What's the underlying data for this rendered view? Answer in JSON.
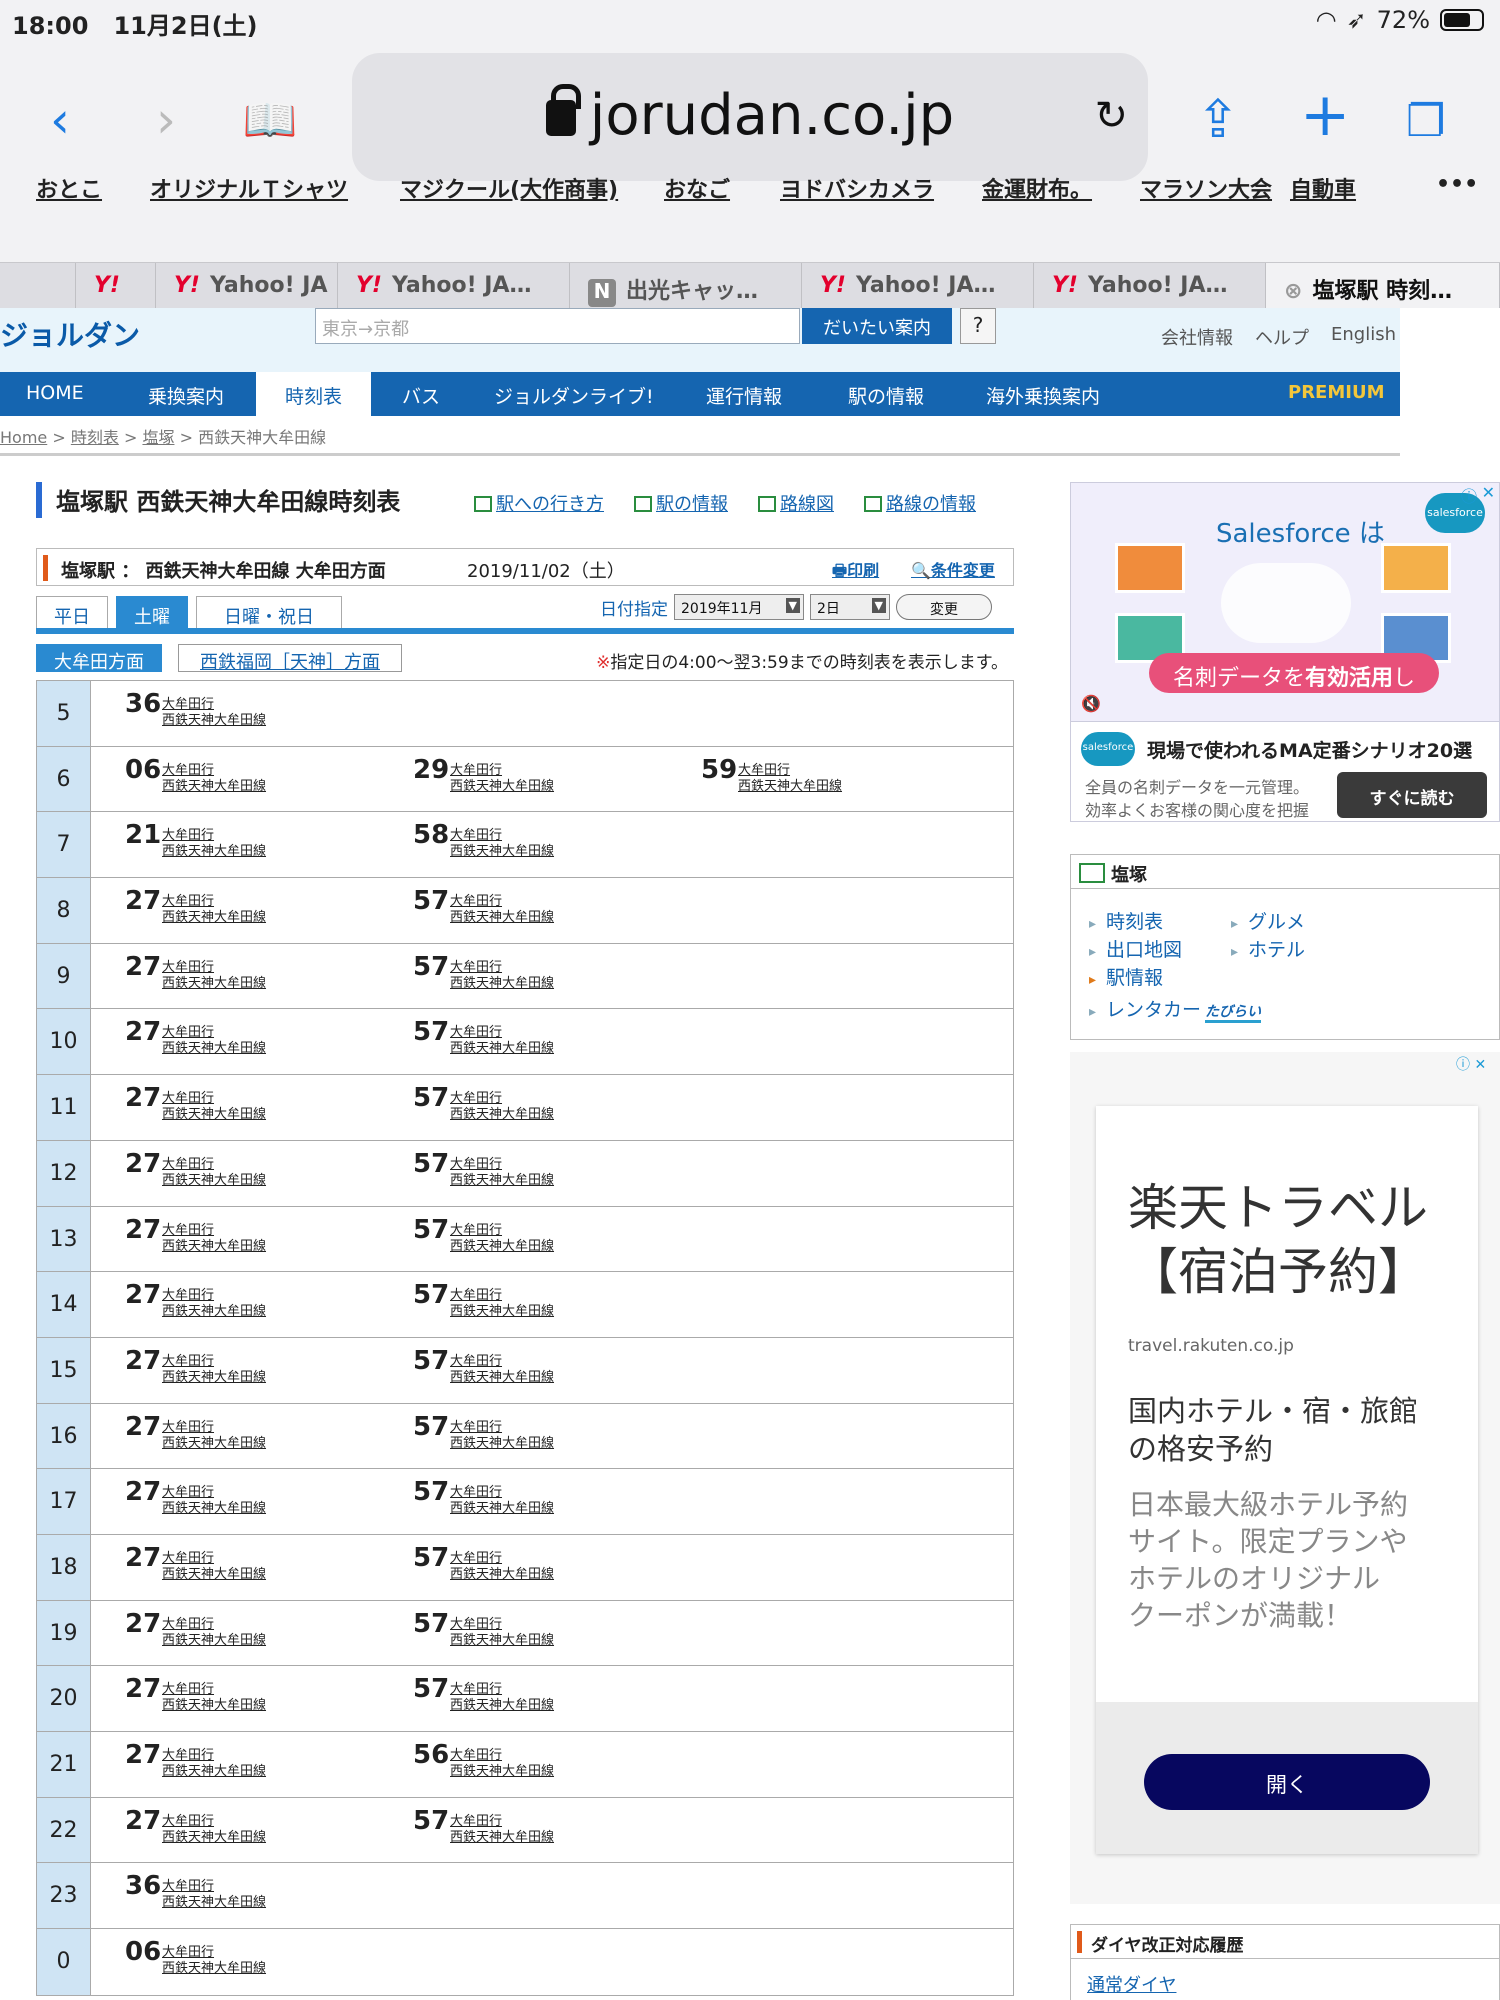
{
  "status": {
    "time": "18:00",
    "date": "11月2日(土)",
    "battery": "72%",
    "battery_level": 0.72
  },
  "browser": {
    "url": "jorudan.co.jp"
  },
  "bookmarks": [
    "おとこ",
    "オリジナルＴシャツ",
    "マジクール(大作商事)",
    "おなご",
    "ヨドバシカメラ",
    "金運財布。",
    "マラソン大会",
    "自動車"
  ],
  "tabs": [
    {
      "label": "Yahoo! JA",
      "favicon": "Y!"
    },
    {
      "label": "Yahoo! JA…",
      "favicon": "Y!"
    },
    {
      "label": "出光キャッ…",
      "favicon": "N"
    },
    {
      "label": "Yahoo! JA…",
      "favicon": "Y!"
    },
    {
      "label": "Yahoo! JA…",
      "favicon": "Y!"
    },
    {
      "label": "塩塚駅 時刻…",
      "favicon": "close"
    }
  ],
  "site": {
    "logo": "ジョルダン",
    "search_placeholder": "東京→京都",
    "search_button": "だいたい案内",
    "help_button": "?",
    "header_links": [
      "会社情報",
      "ヘルプ",
      "English"
    ],
    "nav": [
      "HOME",
      "乗換案内",
      "時刻表",
      "バス",
      "ジョルダンライブ!",
      "運行情報",
      "駅の情報",
      "海外乗換案内"
    ],
    "premium": "PREMIUM",
    "breadcrumb": [
      "Home",
      "時刻表",
      "塩塚",
      "西鉄天神大牟田線"
    ],
    "breadcrumb_sep": ">"
  },
  "main": {
    "title": "塩塚駅 西鉄天神大牟田線時刻表",
    "title_links": [
      "駅への行き方",
      "駅の情報",
      "路線図",
      "路線の情報"
    ],
    "info": "塩塚駅 ： 西鉄天神大牟田線 大牟田方面",
    "info_date": "2019/11/02（土）",
    "print": "印刷",
    "change_cond": "条件変更",
    "day_tabs": [
      "平日",
      "土曜",
      "日曜・祝日"
    ],
    "date_label": "日付指定",
    "month_select": "2019年11月",
    "day_select": "2日",
    "change_button": "変更",
    "dir_tabs": [
      "大牟田方面",
      "西鉄福岡［天神］方面"
    ],
    "note_mark": "※",
    "note": "指定日の4:00〜翌3:59までの時刻表を表示します。",
    "dest": "大牟田行",
    "line": "西鉄天神大牟田線"
  },
  "timetable": [
    {
      "hour": "5",
      "mins": [
        "36"
      ]
    },
    {
      "hour": "6",
      "mins": [
        "06",
        "29",
        "59"
      ]
    },
    {
      "hour": "7",
      "mins": [
        "21",
        "58"
      ]
    },
    {
      "hour": "8",
      "mins": [
        "27",
        "57"
      ]
    },
    {
      "hour": "9",
      "mins": [
        "27",
        "57"
      ]
    },
    {
      "hour": "10",
      "mins": [
        "27",
        "57"
      ]
    },
    {
      "hour": "11",
      "mins": [
        "27",
        "57"
      ]
    },
    {
      "hour": "12",
      "mins": [
        "27",
        "57"
      ]
    },
    {
      "hour": "13",
      "mins": [
        "27",
        "57"
      ]
    },
    {
      "hour": "14",
      "mins": [
        "27",
        "57"
      ]
    },
    {
      "hour": "15",
      "mins": [
        "27",
        "57"
      ]
    },
    {
      "hour": "16",
      "mins": [
        "27",
        "57"
      ]
    },
    {
      "hour": "17",
      "mins": [
        "27",
        "57"
      ]
    },
    {
      "hour": "18",
      "mins": [
        "27",
        "57"
      ]
    },
    {
      "hour": "19",
      "mins": [
        "27",
        "57"
      ]
    },
    {
      "hour": "20",
      "mins": [
        "27",
        "57"
      ]
    },
    {
      "hour": "21",
      "mins": [
        "27",
        "56"
      ]
    },
    {
      "hour": "22",
      "mins": [
        "27",
        "57"
      ]
    },
    {
      "hour": "23",
      "mins": [
        "36"
      ]
    },
    {
      "hour": "0",
      "mins": [
        "06"
      ]
    }
  ],
  "sidebar": {
    "ad1": {
      "brand": "Salesforce は",
      "pill_pre": "名刺データを",
      "pill_bold": "有効活用",
      "pill_post": "し",
      "logo": "salesforce",
      "small_logo": "salesforce",
      "headline": "現場で使われるMA定番シナリオ20選",
      "body1": "全員の名刺データを一元管理。",
      "body2": "効率よくお客様の関心度を把握",
      "button": "すぐに読む"
    },
    "station": {
      "title": "塩塚",
      "items": [
        "時刻表",
        "グルメ",
        "出口地図",
        "ホテル",
        "駅情報",
        "レンタカー"
      ],
      "tabirai": "たびらい"
    },
    "ad2": {
      "title1": "楽天トラベル",
      "title2": "【宿泊予約】",
      "url": "travel.rakuten.co.jp",
      "sub1": "国内ホテル・宿・旅館",
      "sub2": "の格安予約",
      "desc1": "日本最大級ホテル予約",
      "desc2": "サイト。限定プランや",
      "desc3": "ホテルのオリジナル",
      "desc4": "クーポンが満載！",
      "button": "開く"
    },
    "dia": {
      "title": "ダイヤ改正対応履歴",
      "link": "通常ダイヤ"
    }
  }
}
